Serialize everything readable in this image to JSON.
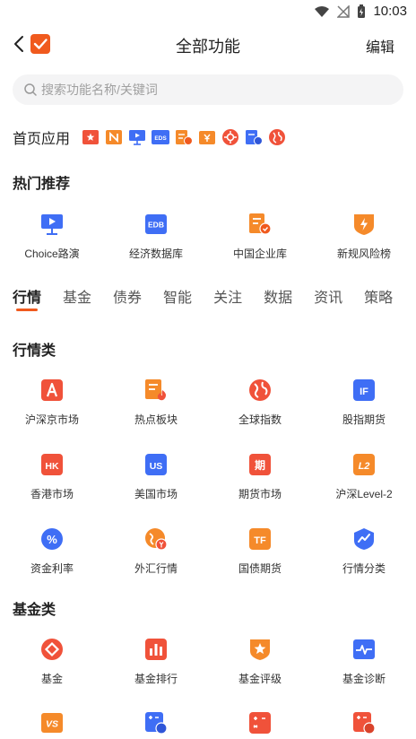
{
  "status": {
    "time": "10:03"
  },
  "header": {
    "title": "全部功能",
    "edit_label": "编辑"
  },
  "search": {
    "placeholder": "搜索功能名称/关键词"
  },
  "home_apps": {
    "label": "首页应用",
    "mini_icon_texts": [
      "EDS"
    ]
  },
  "hot": {
    "title": "热门推荐",
    "items": [
      {
        "label": "Choice路演",
        "icon": "presentation-icon"
      },
      {
        "label": "经济数据库",
        "icon": "edb-icon",
        "icon_text": "EDB"
      },
      {
        "label": "中国企业库",
        "icon": "company-doc-icon"
      },
      {
        "label": "新规风险榜",
        "icon": "lightning-shield-icon"
      }
    ]
  },
  "tabs": {
    "items": [
      {
        "label": "行情",
        "active": true
      },
      {
        "label": "基金"
      },
      {
        "label": "债券"
      },
      {
        "label": "智能"
      },
      {
        "label": "关注"
      },
      {
        "label": "数据"
      },
      {
        "label": "资讯"
      },
      {
        "label": "策略"
      }
    ]
  },
  "quotes": {
    "title": "行情类",
    "rows": [
      [
        {
          "label": "沪深京市场",
          "icon": "a-share-icon",
          "icon_text": "A"
        },
        {
          "label": "热点板块",
          "icon": "hot-sector-icon"
        },
        {
          "label": "全球指数",
          "icon": "globe-icon"
        },
        {
          "label": "股指期货",
          "icon": "if-icon",
          "icon_text": "IF"
        }
      ],
      [
        {
          "label": "香港市场",
          "icon": "hk-icon",
          "icon_text": "HK"
        },
        {
          "label": "美国市场",
          "icon": "us-icon",
          "icon_text": "US"
        },
        {
          "label": "期货市场",
          "icon": "futures-icon",
          "icon_text": "期"
        },
        {
          "label": "沪深Level-2",
          "icon": "level2-icon",
          "icon_text": "L2"
        }
      ],
      [
        {
          "label": "资金利率",
          "icon": "percent-icon",
          "icon_text": "%"
        },
        {
          "label": "外汇行情",
          "icon": "forex-icon"
        },
        {
          "label": "国债期货",
          "icon": "tf-icon",
          "icon_text": "TF"
        },
        {
          "label": "行情分类",
          "icon": "trend-shield-icon"
        }
      ]
    ]
  },
  "funds": {
    "title": "基金类",
    "rows": [
      [
        {
          "label": "基金",
          "icon": "fund-diamond-icon"
        },
        {
          "label": "基金排行",
          "icon": "bar-ranking-icon"
        },
        {
          "label": "基金评级",
          "icon": "star-badge-icon"
        },
        {
          "label": "基金诊断",
          "icon": "pulse-icon"
        }
      ],
      [
        {
          "label": "",
          "icon": "vs-icon",
          "icon_text": "VS"
        },
        {
          "label": "",
          "icon": "calculator-clock-icon"
        },
        {
          "label": "",
          "icon": "calculator-red-icon"
        },
        {
          "label": "",
          "icon": "calculator-alert-icon"
        }
      ]
    ]
  },
  "colors": {
    "accent": "#f05a1e",
    "blue": "#3f6ef5",
    "orange": "#f58a2a"
  }
}
